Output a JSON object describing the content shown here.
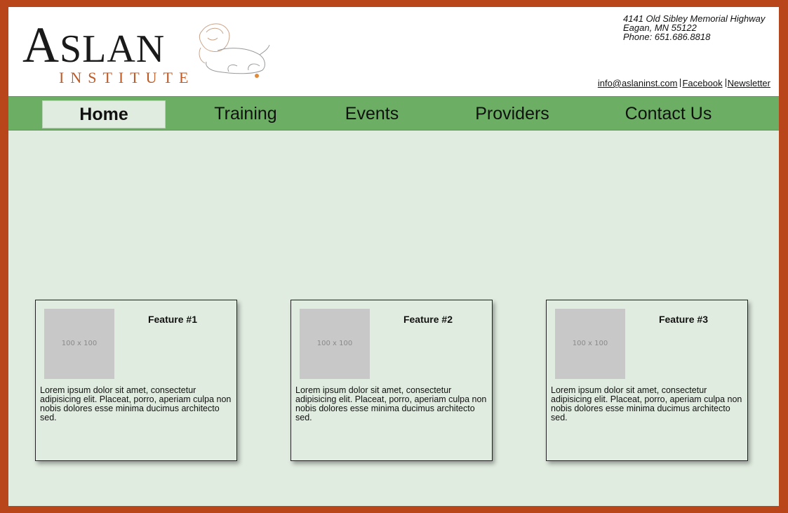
{
  "logo": {
    "word_large": "A",
    "word_rest": "SLAN",
    "sub": "INSTITUTE"
  },
  "contact": {
    "street": "4141 Old Sibley Memorial Highway",
    "city": "Eagan, MN 55122",
    "phone": "Phone: 651.686.8818"
  },
  "toplinks": {
    "email": "info@aslaninst.com",
    "facebook": "Facebook",
    "newsletter": "Newsletter"
  },
  "nav": {
    "items": [
      {
        "label": "Home",
        "active": true
      },
      {
        "label": "Training"
      },
      {
        "label": "Events"
      },
      {
        "label": "Providers"
      },
      {
        "label": "Contact Us"
      }
    ]
  },
  "features": [
    {
      "title": "Feature #1",
      "thumb": "100 x 100",
      "text": "Lorem ipsum dolor sit amet, consectetur adipisicing elit. Placeat, porro, aperiam culpa non nobis dolores esse minima ducimus architecto sed."
    },
    {
      "title": "Feature #2",
      "thumb": "100 x 100",
      "text": "Lorem ipsum dolor sit amet, consectetur adipisicing elit. Placeat, porro, aperiam culpa non nobis dolores esse minima ducimus architecto sed."
    },
    {
      "title": "Feature #3",
      "thumb": "100 x 100",
      "text": "Lorem ipsum dolor sit amet, consectetur adipisicing elit. Placeat, porro, aperiam culpa non nobis dolores esse minima ducimus architecto sed."
    }
  ],
  "colors": {
    "frame": "#b9461a",
    "nav": "#6caf64",
    "content_bg": "#e1ece0",
    "logo_accent": "#c05a25"
  }
}
